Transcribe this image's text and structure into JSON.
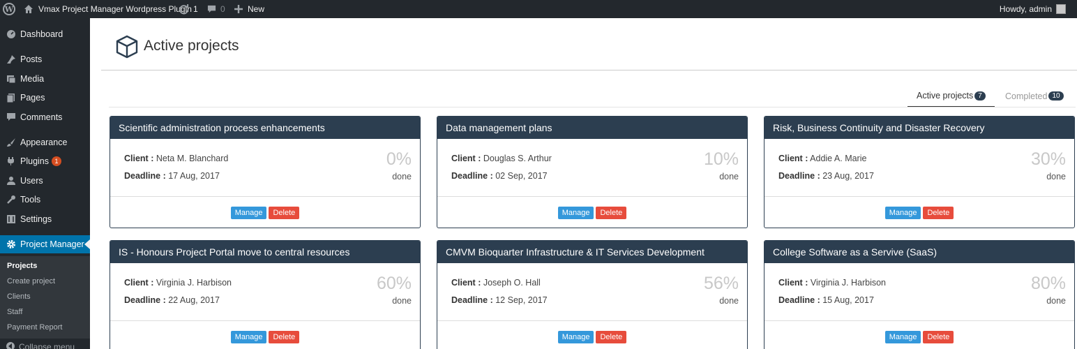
{
  "adminbar": {
    "site_name": "Vmax Project Manager Wordpress Plugin",
    "updates_count": "1",
    "comments_count": "0",
    "new_label": "New",
    "howdy": "Howdy, admin"
  },
  "sidebar": {
    "items": [
      {
        "label": "Dashboard",
        "icon": "dashboard-icon"
      },
      {
        "label": "Posts",
        "icon": "pin-icon"
      },
      {
        "label": "Media",
        "icon": "media-icon"
      },
      {
        "label": "Pages",
        "icon": "pages-icon"
      },
      {
        "label": "Comments",
        "icon": "comment-icon"
      },
      {
        "label": "Appearance",
        "icon": "brush-icon"
      },
      {
        "label": "Plugins",
        "icon": "plug-icon",
        "badge": "1"
      },
      {
        "label": "Users",
        "icon": "user-icon"
      },
      {
        "label": "Tools",
        "icon": "wrench-icon"
      },
      {
        "label": "Settings",
        "icon": "settings-icon"
      },
      {
        "label": "Project Manager",
        "icon": "gear-icon"
      }
    ],
    "submenu": [
      "Projects",
      "Create project",
      "Clients",
      "Staff",
      "Payment Report"
    ],
    "collapse_label": "Collapse menu"
  },
  "page": {
    "title": "Active projects",
    "tabs": [
      {
        "label": "Active projects",
        "count": "7"
      },
      {
        "label": "Completed",
        "count": "10"
      }
    ],
    "client_label": "Client :",
    "deadline_label": "Deadline :",
    "done_label": "done",
    "manage_label": "Manage",
    "delete_label": "Delete"
  },
  "projects": [
    {
      "title": "Scientific administration process enhancements",
      "client": "Neta M. Blanchard",
      "deadline": "17 Aug, 2017",
      "percent": "0%"
    },
    {
      "title": "Data management plans",
      "client": "Douglas S. Arthur",
      "deadline": "02 Sep, 2017",
      "percent": "10%"
    },
    {
      "title": "Risk, Business Continuity and Disaster Recovery",
      "client": "Addie A. Marie",
      "deadline": "23 Aug, 2017",
      "percent": "30%"
    },
    {
      "title": "IS - Honours Project Portal move to central resources",
      "client": "Virginia J. Harbison",
      "deadline": "22 Aug, 2017",
      "percent": "60%"
    },
    {
      "title": "CMVM Bioquarter Infrastructure & IT Services Development",
      "client": "Joseph O. Hall",
      "deadline": "12 Sep, 2017",
      "percent": "56%"
    },
    {
      "title": "College Software as a Servive (SaaS)",
      "client": "Virginia J. Harbison",
      "deadline": "15 Aug, 2017",
      "percent": "80%"
    }
  ]
}
